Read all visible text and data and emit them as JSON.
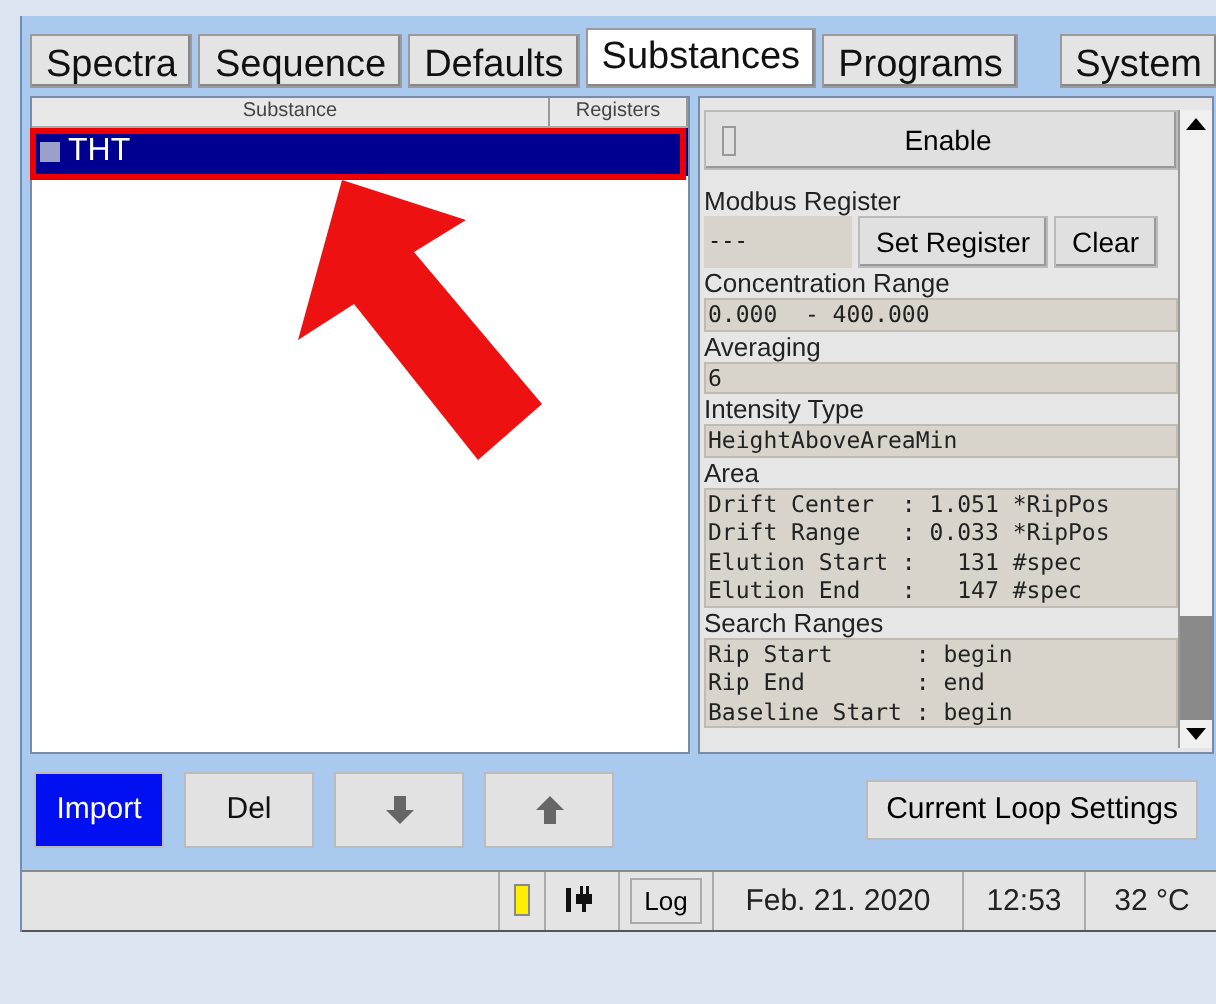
{
  "tabs": [
    {
      "label": "Spectra",
      "selected": false
    },
    {
      "label": "Sequence",
      "selected": false
    },
    {
      "label": "Defaults",
      "selected": false
    },
    {
      "label": "Substances",
      "selected": true
    },
    {
      "label": "Programs",
      "selected": false
    },
    {
      "label": "System",
      "selected": false
    }
  ],
  "list": {
    "columns": [
      "Substance",
      "Registers"
    ],
    "rows": [
      {
        "name": "THT",
        "selected": true
      }
    ]
  },
  "panel": {
    "enable": {
      "label": "Enable",
      "checked": false
    },
    "modbus": {
      "label": "Modbus Register",
      "value": "---",
      "buttons": [
        "Set Register",
        "Clear"
      ]
    },
    "fields": [
      {
        "label": "Concentration Range",
        "lines": [
          "0.000  - 400.000"
        ]
      },
      {
        "label": "Averaging",
        "lines": [
          "6"
        ]
      },
      {
        "label": "Intensity Type",
        "lines": [
          "HeightAboveAreaMin"
        ]
      },
      {
        "label": "Area",
        "lines": [
          "Drift Center  : 1.051 *RipPos",
          "Drift Range   : 0.033 *RipPos",
          "Elution Start :   131 #spec",
          "Elution End   :   147 #spec"
        ]
      },
      {
        "label": "Search Ranges",
        "lines": [
          "Rip Start      : begin",
          "Rip End        : end",
          "Baseline Start : begin"
        ]
      }
    ]
  },
  "buttons": [
    {
      "kind": "text",
      "label": "Import",
      "selected": true
    },
    {
      "kind": "text",
      "label": "Del",
      "selected": false
    },
    {
      "kind": "down",
      "selected": false
    },
    {
      "kind": "up",
      "selected": false
    }
  ],
  "loop_button": "Current Loop Settings",
  "status": {
    "log": "Log",
    "date": "Feb. 21. 2020",
    "time": "12:53",
    "temperature": "32 °C"
  }
}
